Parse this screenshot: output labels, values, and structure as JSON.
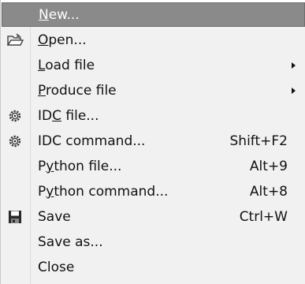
{
  "menu": {
    "items": [
      {
        "pre": "",
        "key": "N",
        "post": "ew...",
        "shortcut": "",
        "submenu": false,
        "icon": "",
        "selected": true
      },
      {
        "pre": "",
        "key": "O",
        "post": "pen...",
        "shortcut": "",
        "submenu": false,
        "icon": "open-folder-icon",
        "selected": false
      },
      {
        "pre": "",
        "key": "L",
        "post": "oad file",
        "shortcut": "",
        "submenu": true,
        "icon": "",
        "selected": false
      },
      {
        "pre": "",
        "key": "P",
        "post": "roduce file",
        "shortcut": "",
        "submenu": true,
        "icon": "",
        "selected": false
      },
      {
        "pre": "ID",
        "key": "C",
        "post": " file...",
        "shortcut": "",
        "submenu": false,
        "icon": "gear-icon",
        "selected": false
      },
      {
        "pre": "IDC command...",
        "key": "",
        "post": "",
        "shortcut": "Shift+F2",
        "submenu": false,
        "icon": "gear-icon",
        "selected": false
      },
      {
        "pre": "P",
        "key": "y",
        "post": "thon file...",
        "shortcut": "Alt+9",
        "submenu": false,
        "icon": "",
        "selected": false
      },
      {
        "pre": "P",
        "key": "y",
        "post": "thon command...",
        "shortcut": "Alt+8",
        "submenu": false,
        "icon": "",
        "selected": false
      },
      {
        "pre": "Save",
        "key": "",
        "post": "",
        "shortcut": "Ctrl+W",
        "submenu": false,
        "icon": "floppy-disk-icon",
        "selected": false
      },
      {
        "pre": "Save as...",
        "key": "",
        "post": "",
        "shortcut": "",
        "submenu": false,
        "icon": "",
        "selected": false
      },
      {
        "pre": "Close",
        "key": "",
        "post": "",
        "shortcut": "",
        "submenu": false,
        "icon": "",
        "selected": false
      }
    ]
  },
  "colors": {
    "menu_bg": "#f1f1f1",
    "selected_bg": "#8a8a8a",
    "text": "#111111"
  }
}
